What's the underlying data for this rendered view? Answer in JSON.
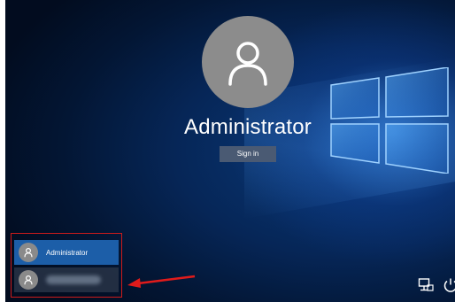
{
  "lock_screen": {
    "user_name": "Administrator",
    "sign_in_label": "Sign in"
  },
  "user_switcher": {
    "users": [
      {
        "label": "Administrator",
        "selected": true
      },
      {
        "label": "",
        "selected": false
      }
    ]
  },
  "icons": {
    "user_avatar": "user-icon",
    "network": "network-icon",
    "power": "power-icon",
    "logo": "windows-logo"
  },
  "colors": {
    "selected_user": "#1c5ea8",
    "sign_in_button": "#4a5a73",
    "annotation": "#cc1b1b"
  }
}
